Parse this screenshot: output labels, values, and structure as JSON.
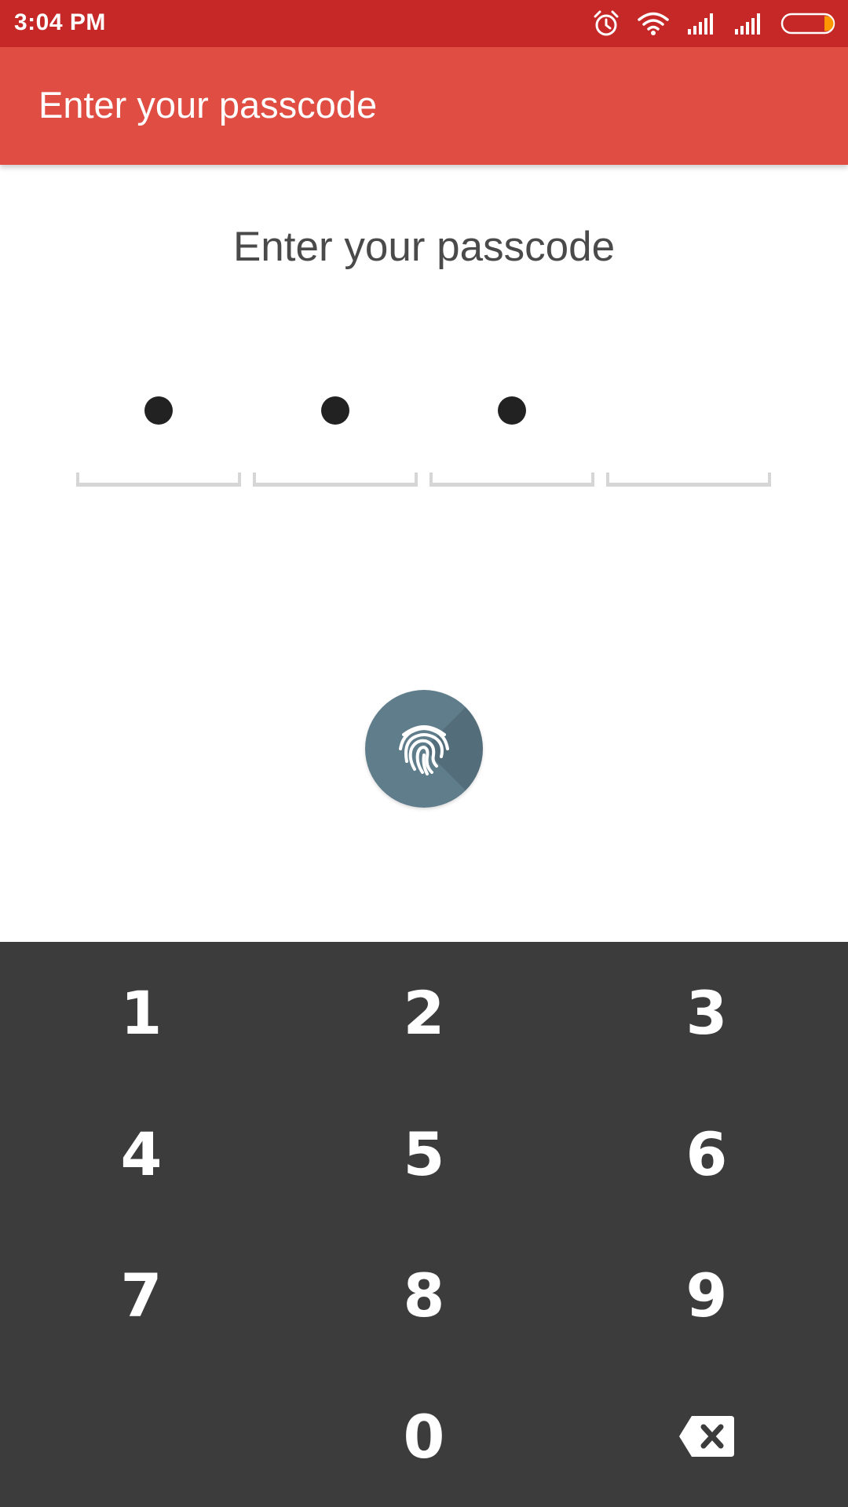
{
  "status_bar": {
    "time": "3:04 PM",
    "icons": [
      "alarm-icon",
      "wifi-icon",
      "signal-icon",
      "signal-icon",
      "battery-icon"
    ],
    "battery_level": 0.15
  },
  "app_bar": {
    "title": "Enter your passcode"
  },
  "content": {
    "prompt": "Enter your passcode",
    "pin_length": 4,
    "pin_filled": 3
  },
  "fingerprint": {
    "icon": "fingerprint-icon",
    "color": "#607d8b"
  },
  "keypad": {
    "keys": [
      {
        "label": "1"
      },
      {
        "label": "2"
      },
      {
        "label": "3"
      },
      {
        "label": "4"
      },
      {
        "label": "5"
      },
      {
        "label": "6"
      },
      {
        "label": "7"
      },
      {
        "label": "8"
      },
      {
        "label": "9"
      },
      {
        "label": ""
      },
      {
        "label": "0"
      },
      {
        "icon": "backspace-icon"
      }
    ]
  },
  "colors": {
    "status_bar": "#c62828",
    "app_bar": "#e04d43",
    "keypad_bg": "#3c3c3c",
    "prompt_text": "#4a4a4a"
  }
}
